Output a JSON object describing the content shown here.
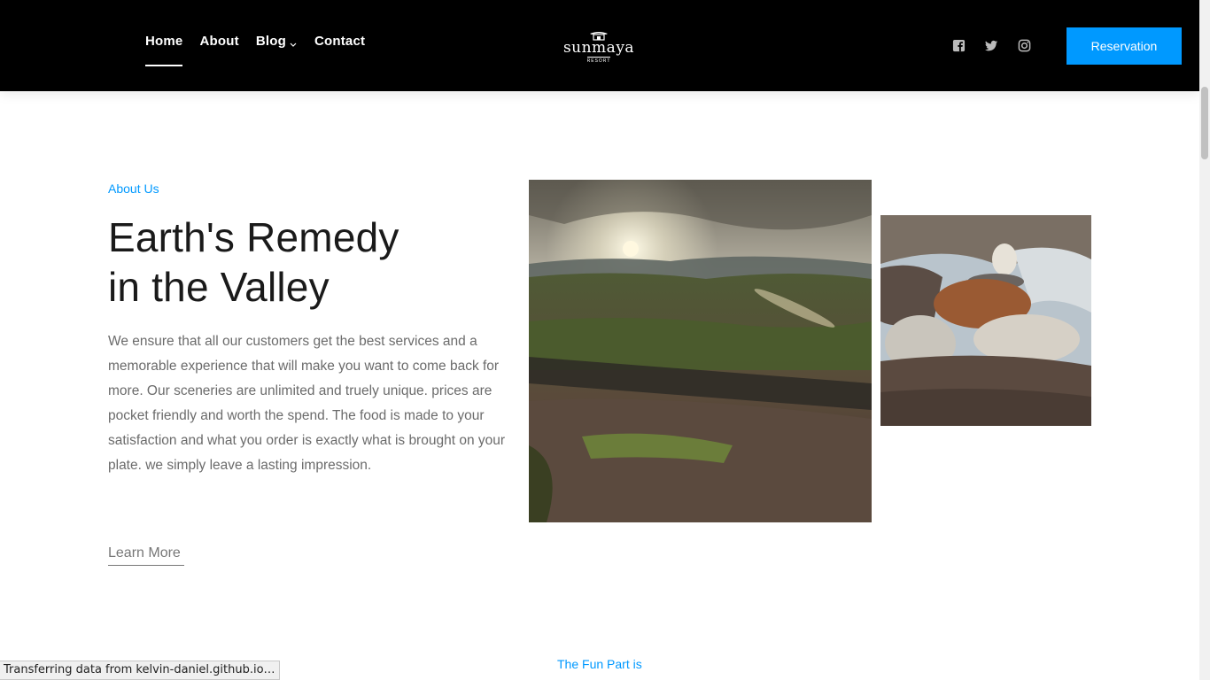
{
  "header": {
    "nav": [
      {
        "label": "Home"
      },
      {
        "label": "About"
      },
      {
        "label": "Blog"
      },
      {
        "label": "Contact"
      }
    ],
    "logo": {
      "name": "sunmaya",
      "sub": "RESORT"
    },
    "social_icons": [
      "facebook-icon",
      "twitter-icon",
      "instagram-icon"
    ],
    "reservation_label": "Reservation"
  },
  "about": {
    "eyebrow": "About Us",
    "title_line1": "Earth's Remedy",
    "title_line2": "in the Valley",
    "description": "We ensure that all our customers get the best services and a memorable experience that will make you want to come back for more. Our sceneries are unlimited and truely unique. prices are pocket friendly and worth the spend. The food is made to your satisfaction and what you order is exactly what is brought on your plate. we simply leave a lasting impression.",
    "learn_more": "Learn More"
  },
  "next_section": {
    "eyebrow": "The Fun Part is"
  },
  "status_bar": {
    "text": "Transferring data from kelvin-daniel.github.io…"
  },
  "colors": {
    "accent": "#0099ff",
    "header_bg": "#000000",
    "text_muted": "#6b6b6b"
  }
}
